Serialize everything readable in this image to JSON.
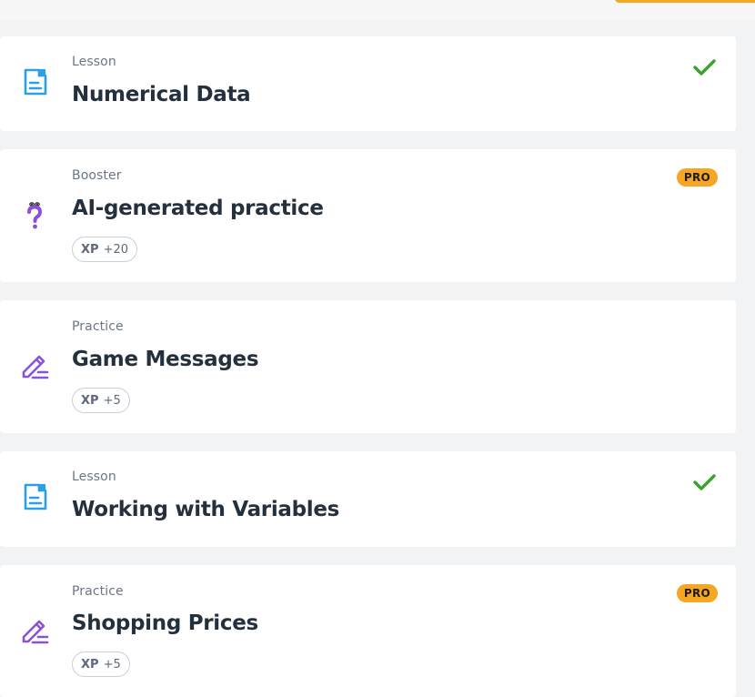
{
  "items": [
    {
      "type_label": "Lesson",
      "title": "Numerical Data",
      "icon": "lesson-document-icon",
      "status": "completed",
      "status_icon": "checkmark-icon"
    },
    {
      "type_label": "Booster",
      "title": "AI-generated practice",
      "icon": "ai-question-icon",
      "badge": "PRO",
      "xp_label": "XP",
      "xp_value": "+20"
    },
    {
      "type_label": "Practice",
      "title": "Game Messages",
      "icon": "practice-pencil-icon",
      "xp_label": "XP",
      "xp_value": "+5"
    },
    {
      "type_label": "Lesson",
      "title": "Working with Variables",
      "icon": "lesson-document-icon",
      "status": "completed",
      "status_icon": "checkmark-icon"
    },
    {
      "type_label": "Practice",
      "title": "Shopping Prices",
      "icon": "practice-pencil-icon",
      "badge": "PRO",
      "xp_label": "XP",
      "xp_value": "+5"
    }
  ],
  "colors": {
    "lesson_icon": "#2aa1e6",
    "practice_icon": "#8a52d8",
    "check": "#3aa32e",
    "pro_badge": "#f5a623",
    "title_text": "#24303d",
    "meta_text": "#6b7684",
    "background": "#f2f3f5",
    "card": "#ffffff"
  }
}
